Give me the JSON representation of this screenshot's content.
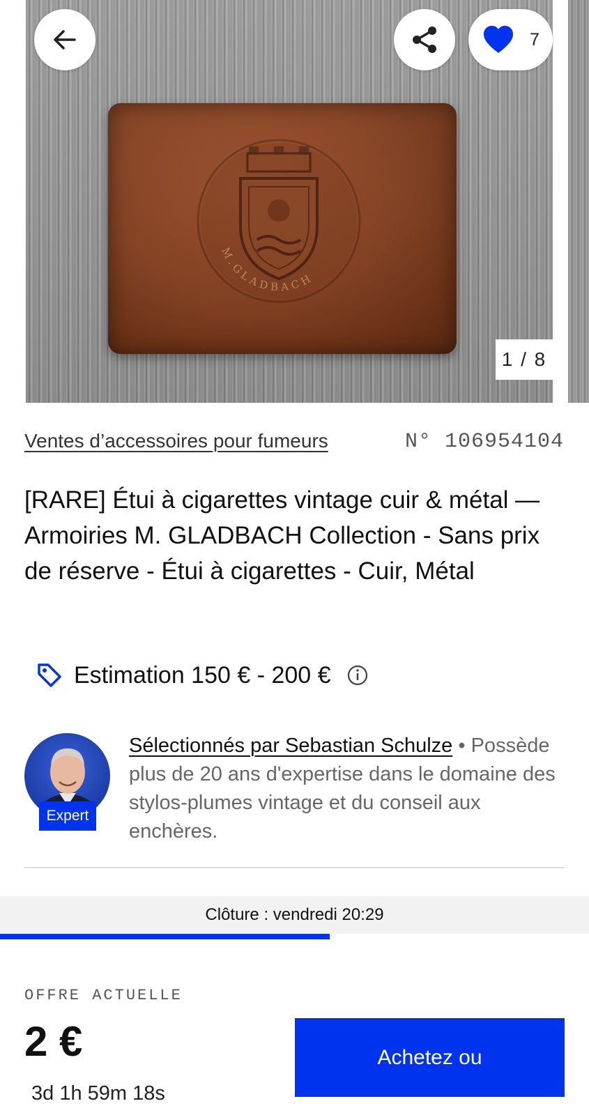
{
  "gallery": {
    "counter": "1 / 8",
    "favorites_count": "7",
    "image_engraving": "M.GLADBACH"
  },
  "lot": {
    "category": "Ventes d’accessoires pour fumeurs",
    "number": "N° 106954104",
    "title": "[RARE] Étui à cigarettes vintage cuir & métal — Armoiries M. GLADBACH Collection - Sans prix de réserve - Étui à cigarettes - Cuir, Métal"
  },
  "estimate": {
    "text": "Estimation 150 € - 200 €"
  },
  "expert": {
    "name_link": "Sélectionnés par Sebastian Schulze",
    "separator": " • ",
    "bio": "Possède plus de 20 ans d'expertise dans le domaine des stylos-plumes vintage et du conseil aux enchères.",
    "badge": "Expert"
  },
  "closing": {
    "text": "Clôture : vendredi 20:29",
    "progress_fraction": 0.56
  },
  "bid": {
    "label": "OFFRE ACTUELLE",
    "value": "2 €",
    "countdown": "3d 1h 59m 18s",
    "button_label": "Achetez ou"
  },
  "colors": {
    "accent": "#0033ee",
    "text": "#111111",
    "muted": "#666666"
  },
  "icons": [
    "back-arrow-icon",
    "share-icon",
    "heart-icon",
    "tag-icon",
    "info-icon"
  ]
}
